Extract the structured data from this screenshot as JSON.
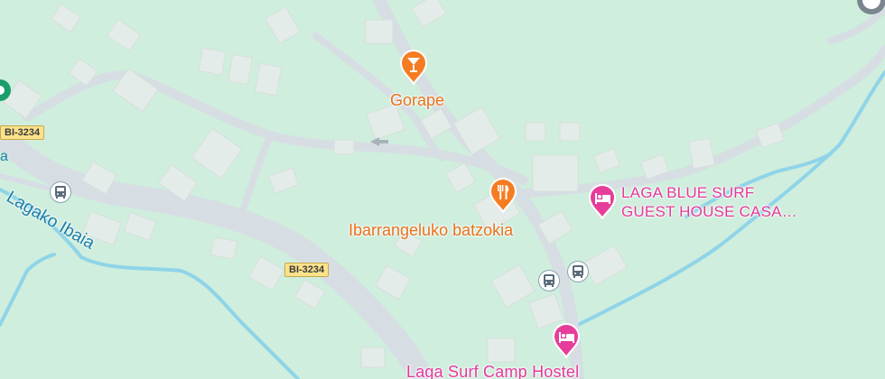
{
  "map": {
    "places": {
      "gorape": {
        "name": "Gorape",
        "icon": "cocktail-icon",
        "category": "bar"
      },
      "ibarrangeluko": {
        "name": "Ibarrangeluko batzokia",
        "icon": "fork-knife-icon",
        "category": "restaurant"
      },
      "laga_blue_surf": {
        "line1": "LAGA BLUE SURF",
        "line2": "GUEST HOUSE CASA…",
        "icon": "bed-icon",
        "category": "lodging"
      },
      "laga_surf_camp": {
        "name": "Laga Surf Camp Hostel",
        "icon": "bed-icon",
        "category": "lodging"
      }
    },
    "roads": {
      "shield_1": "BI-3234",
      "shield_2": "BI-3234"
    },
    "water": {
      "river": "Lagako Ibaia",
      "partial_left": "a"
    },
    "transit_icon": "bus-icon",
    "colors": {
      "land": "#cfeedd",
      "road": "#d6dde2",
      "building": "#e3eae8",
      "water": "#8fd4e8",
      "food_pin": "#f57c22",
      "hotel_pin": "#e63d9b",
      "route_shield": "#fbe28b"
    }
  }
}
